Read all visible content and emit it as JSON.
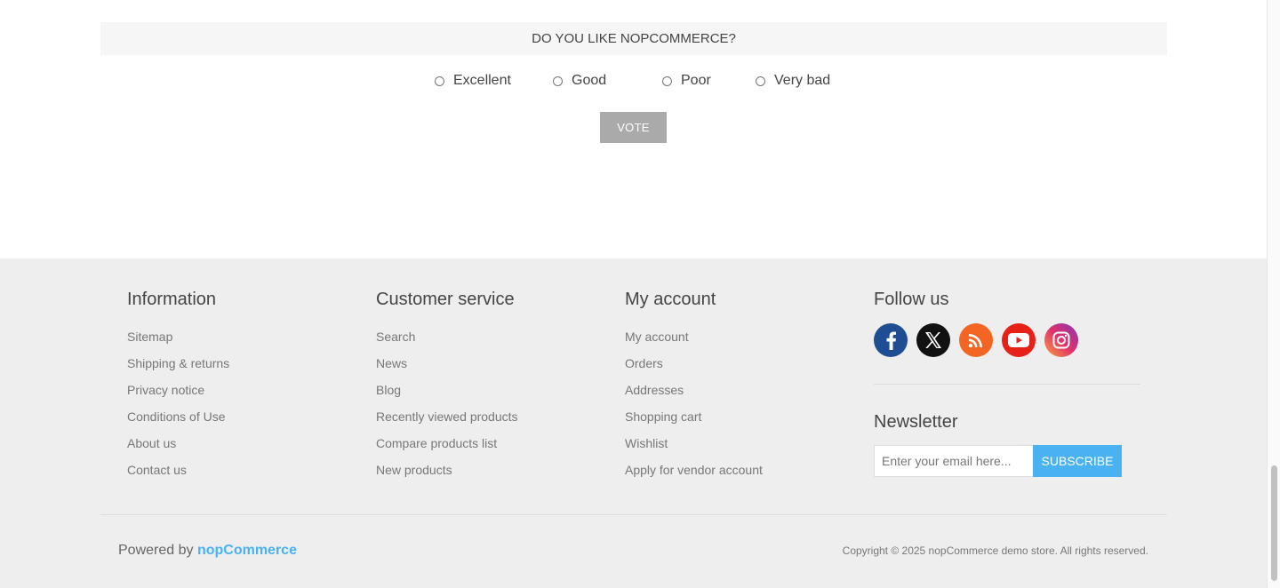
{
  "poll": {
    "question": "DO YOU LIKE NOPCOMMERCE?",
    "options": [
      "Excellent",
      "Good",
      "Poor",
      "Very bad"
    ],
    "vote_label": "VOTE"
  },
  "footer": {
    "information": {
      "title": "Information",
      "links": [
        "Sitemap",
        "Shipping & returns",
        "Privacy notice",
        "Conditions of Use",
        "About us",
        "Contact us"
      ]
    },
    "customer_service": {
      "title": "Customer service",
      "links": [
        "Search",
        "News",
        "Blog",
        "Recently viewed products",
        "Compare products list",
        "New products"
      ]
    },
    "my_account": {
      "title": "My account",
      "links": [
        "My account",
        "Orders",
        "Addresses",
        "Shopping cart",
        "Wishlist",
        "Apply for vendor account"
      ]
    },
    "follow": {
      "title": "Follow us",
      "icons": [
        "facebook-icon",
        "x-icon",
        "rss-icon",
        "youtube-icon",
        "instagram-icon"
      ],
      "colors": {
        "facebook": "#1f4d94",
        "x": "#111111",
        "rss": "#f26522",
        "youtube": "#e62117",
        "instagram": "#c13584"
      }
    },
    "newsletter": {
      "title": "Newsletter",
      "placeholder": "Enter your email here...",
      "button_label": "SUBSCRIBE"
    },
    "powered_by_prefix": "Powered by",
    "powered_by_brand": "nopCommerce",
    "copyright": "Copyright © 2025 nopCommerce demo store. All rights reserved."
  },
  "colors": {
    "accent": "#4ab2f1",
    "vote_button": "#aaaaaa",
    "footer_bg": "#eeeeee"
  }
}
